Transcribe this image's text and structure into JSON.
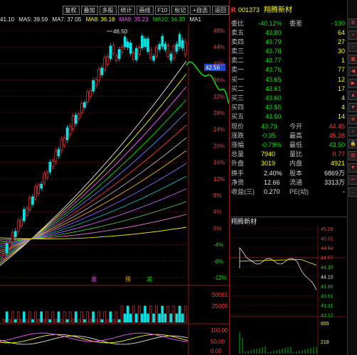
{
  "toolbar": {
    "buttons": [
      "复权",
      "叠加",
      "多股",
      "统计",
      "画线",
      "F10",
      "标记",
      "+自选",
      "返回"
    ]
  },
  "indicators": {
    "price_label": "41.10",
    "ma5": "MA5: 39.59",
    "ma7": "MA7: 37.05",
    "ma8": "MA8: 36.18",
    "ma9": "MA9: 35.23",
    "ma10": "MA10: 34.33",
    "ma1": "MA1"
  },
  "chart": {
    "high_marker": "46.50",
    "current_price_tag": "42.56",
    "pct_axis": [
      "48%",
      "44%",
      "40%",
      "36%",
      "32%",
      "28%",
      "24%",
      "20%",
      "16%",
      "12%",
      "8%",
      "4%",
      "0%",
      "-4%",
      "-8%",
      "-12%"
    ],
    "volume_axis": [
      "50561",
      "25000"
    ],
    "macd_axis": [
      "100.00",
      "50.00",
      "0.00"
    ],
    "signals": [
      "涨",
      "预",
      "减"
    ],
    "colors": {
      "up": "#ff3b3b",
      "down": "#00e6e6",
      "bg": "#000000"
    }
  },
  "quote": {
    "code": "001373",
    "name": "翔腾新材",
    "webi_label": "委比",
    "webi_value": "-40.12%",
    "weicha_label": "委差",
    "weicha_value": "-130",
    "sell": [
      {
        "label": "卖五",
        "price": "43.80",
        "vol": "64"
      },
      {
        "label": "卖四",
        "price": "43.79",
        "vol": "27"
      },
      {
        "label": "卖三",
        "price": "43.78",
        "vol": "30"
      },
      {
        "label": "卖二",
        "price": "43.77",
        "vol": "1"
      },
      {
        "label": "卖一",
        "price": "43.76",
        "vol": "77"
      }
    ],
    "buy": [
      {
        "label": "买一",
        "price": "43.65",
        "vol": "12"
      },
      {
        "label": "买二",
        "price": "43.61",
        "vol": "17"
      },
      {
        "label": "买三",
        "price": "43.60",
        "vol": "4"
      },
      {
        "label": "买四",
        "price": "43.55",
        "vol": "4"
      },
      {
        "label": "买五",
        "price": "43.50",
        "vol": "14"
      }
    ],
    "stats": [
      {
        "l1": "现价",
        "v1": "43.79",
        "l2": "今开",
        "v2": "44.45"
      },
      {
        "l1": "涨跌",
        "v1": "-0.35",
        "l2": "最高",
        "v2": "45.28"
      },
      {
        "l1": "涨幅",
        "v1": "-0.79%",
        "l2": "最低",
        "v2": "43.50"
      },
      {
        "l1": "总量",
        "v1": "7940",
        "l2": "量比",
        "v2": "0.77"
      },
      {
        "l1": "外盘",
        "v1": "3019",
        "l2": "内盘",
        "v2": "4921"
      }
    ],
    "stats2": [
      {
        "l1": "换手",
        "v1": "2.40%",
        "l2": "股本",
        "v2": "6869万"
      },
      {
        "l1": "净资",
        "v1": "12.66",
        "l2": "流通",
        "v2": "3313万"
      },
      {
        "l1": "收益(三)",
        "v1": "0.270",
        "l2": "PE(动)",
        "v2": "-"
      }
    ],
    "mini_title": "翔腾新材",
    "mini_axis": [
      "45.28",
      "45.01",
      "44.84",
      "44.57",
      "44.30",
      "44.10",
      "43.80",
      "43.61",
      "43.31",
      "43.12"
    ],
    "mini_vol_axis": [
      "655",
      "218"
    ]
  },
  "side_icons": [
    "settings-icon",
    "zoom-in-icon",
    "zoom-out-icon",
    "grid-icon",
    "left-icon",
    "right-icon",
    "up-icon",
    "down-icon",
    "zoom-icon",
    "search-icon",
    "lock-icon",
    "chart-icon",
    "down-icon",
    "return-icon",
    "more-icon"
  ]
}
